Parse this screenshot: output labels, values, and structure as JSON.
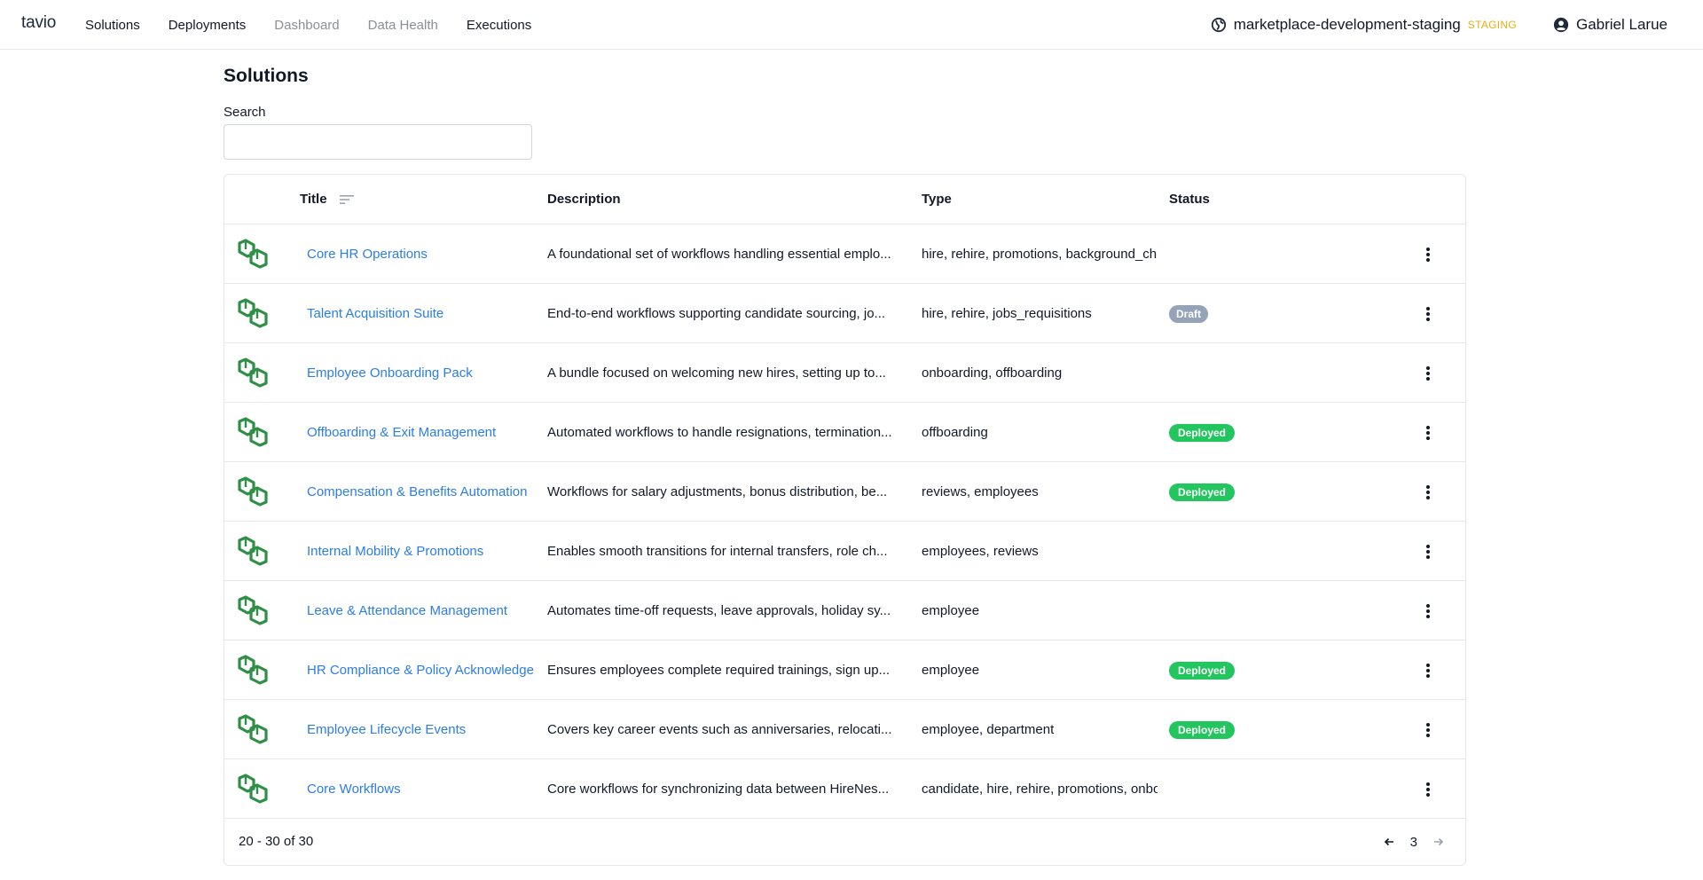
{
  "brand": "tavio",
  "nav": [
    "Solutions",
    "Deployments",
    "Dashboard",
    "Data Health",
    "Executions"
  ],
  "environment": {
    "name": "marketplace-development-staging",
    "badge": "STAGING",
    "badge_color": "#e3b015"
  },
  "user": {
    "name": "Gabriel Larue"
  },
  "page": {
    "title": "Solutions",
    "search_label": "Search",
    "search_value": ""
  },
  "table": {
    "columns": {
      "title": "Title",
      "description": "Description",
      "type": "Type",
      "status": "Status"
    },
    "rows": [
      {
        "title": "Core HR Operations",
        "description": "A foundational set of workflows handling essential emplo...",
        "type": "hire, rehire, promotions, background_ch",
        "status": ""
      },
      {
        "title": "Talent Acquisition Suite",
        "description": "End-to-end workflows supporting candidate sourcing, jo...",
        "type": "hire, rehire, jobs_requisitions",
        "status": "Draft"
      },
      {
        "title": "Employee Onboarding Pack",
        "description": "A bundle focused on welcoming new hires, setting up to...",
        "type": "onboarding, offboarding",
        "status": ""
      },
      {
        "title": "Offboarding & Exit Management",
        "description": "Automated workflows to handle resignations, termination...",
        "type": "offboarding",
        "status": "Deployed"
      },
      {
        "title": "Compensation & Benefits Automation",
        "description": "Workflows for salary adjustments, bonus distribution, be...",
        "type": "reviews, employees",
        "status": "Deployed"
      },
      {
        "title": "Internal Mobility & Promotions",
        "description": "Enables smooth transitions for internal transfers, role ch...",
        "type": "employees, reviews",
        "status": ""
      },
      {
        "title": "Leave & Attendance Management",
        "description": "Automates time-off requests, leave approvals, holiday sy...",
        "type": "employee",
        "status": ""
      },
      {
        "title": "HR Compliance & Policy Acknowledge",
        "description": "Ensures employees complete required trainings, sign up...",
        "type": "employee",
        "status": "Deployed"
      },
      {
        "title": "Employee Lifecycle Events",
        "description": "Covers key career events such as anniversaries, relocati...",
        "type": "employee, department",
        "status": "Deployed"
      },
      {
        "title": "Core Workflows",
        "description": "Core workflows for synchronizing data between HireNes...",
        "type": "candidate, hire, rehire, promotions, onbo",
        "status": ""
      }
    ],
    "pagination": {
      "range": "20 - 30 of 30",
      "page": "3"
    }
  },
  "colors": {
    "link": "#2b7de9",
    "deployed": "#22c55e",
    "draft": "#94a3b8",
    "logo": "#2f8f46"
  }
}
